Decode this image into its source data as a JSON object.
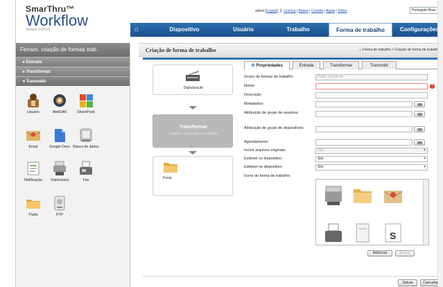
{
  "brand": {
    "name": "SmarThru™",
    "product": "Workflow",
    "version": "Version 3.00.53"
  },
  "top_links": {
    "user": "admin",
    "logout": "Logout",
    "separator": "||",
    "links": [
      "Licença",
      "Baixar",
      "Contato",
      "Ajuda",
      "Sobre"
    ],
    "language": "Português Bras"
  },
  "nav": {
    "items": [
      "Dispositivo",
      "Usuário",
      "Trabalho",
      "Forma de trabalho",
      "Configurações"
    ],
    "active": "Forma de trabalho"
  },
  "sidebar": {
    "title": "Ferram. criação de formas trab.",
    "sections": [
      "Entrada",
      "Transformar",
      "Transmitir"
    ],
    "tools": [
      {
        "label": "Usuário",
        "icon": "user-folder-icon"
      },
      {
        "label": "WebDAV",
        "icon": "webdav-globe-icon"
      },
      {
        "label": "SharePoint",
        "icon": "sharepoint-icon"
      },
      {
        "label": "Email",
        "icon": "email-icon"
      },
      {
        "label": "Google Docs",
        "icon": "google-docs-icon"
      },
      {
        "label": "Banco de dados",
        "icon": "database-icon"
      },
      {
        "label": "Notificação",
        "icon": "notification-icon"
      },
      {
        "label": "Impressora",
        "icon": "printer-icon"
      },
      {
        "label": "Fax",
        "icon": "fax-icon"
      },
      {
        "label": "Pasta",
        "icon": "folder-icon"
      },
      {
        "label": "FTP",
        "icon": "ftp-icon"
      }
    ]
  },
  "main": {
    "title": "Criação de forma de trabalho",
    "breadcrumb": "Forma de trabalho > Criação de forma de trabalho",
    "flow": {
      "input_label": "Digitalização",
      "transform_title": "Transformar",
      "transform_hint": "Arrastar e soltar ações à esquerda",
      "output_label": "Pasta"
    },
    "tabs": [
      "Propriedades",
      "Entrada",
      "Transformar",
      "Transmitir"
    ],
    "fields": {
      "group_label": "Grupo de formas de trabalho:",
      "group_value": "Public Workform",
      "name_label": "Nome:",
      "description_label": "Descrição:",
      "metadata_label": "Metadados:",
      "user_group_label": "Atribuição de grupo de usuários:",
      "device_group_label": "Atribuição de grupo de dispositivos:",
      "schedule_label": "Agendamento:",
      "include_originals_label": "Incluir arquivos originais:",
      "include_originals_value": "Não",
      "visible_label": "Exibível no dispositivo:",
      "visible_value": "Sim",
      "editable_label": "Editável no dispositivo:",
      "editable_value": "Sim",
      "icon_label": "Ícone de forma de trabalho:"
    },
    "icon_buttons": {
      "add": "Adicionar",
      "remove": "Excluir"
    },
    "footer": {
      "save": "Salvar",
      "cancel": "Cancelar"
    }
  }
}
